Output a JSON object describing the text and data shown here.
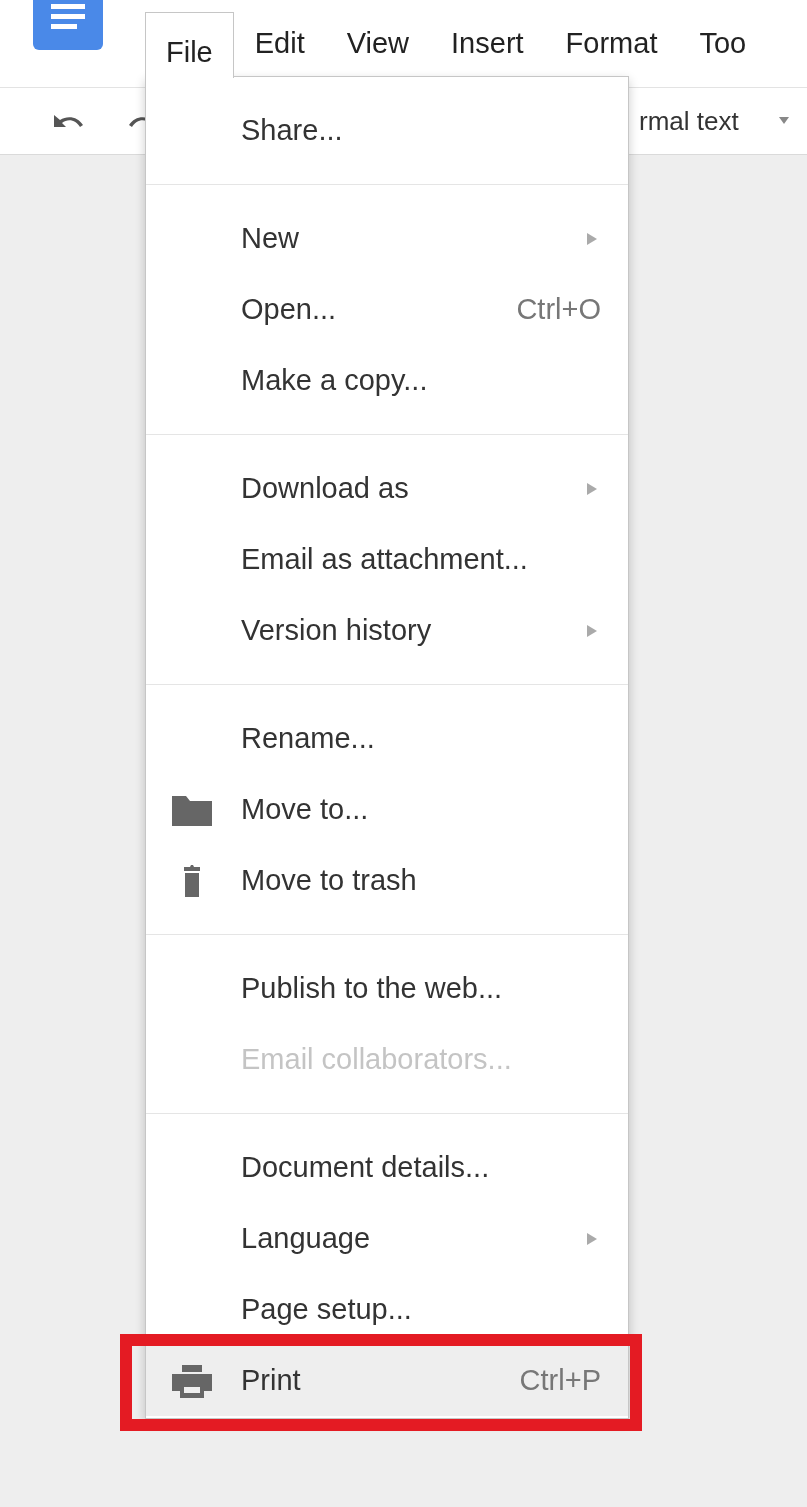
{
  "menubar": [
    {
      "label": "File",
      "selected": true
    },
    {
      "label": "Edit",
      "selected": false
    },
    {
      "label": "View",
      "selected": false
    },
    {
      "label": "Insert",
      "selected": false
    },
    {
      "label": "Format",
      "selected": false
    },
    {
      "label": "Too",
      "selected": false
    }
  ],
  "toolbar": {
    "style_dropdown": "rmal text"
  },
  "file_menu": {
    "sections": [
      {
        "items": [
          {
            "label": "Share...",
            "submenu": false,
            "disabled": false,
            "selected": false,
            "outlined": false
          }
        ]
      },
      {
        "items": [
          {
            "label": "New",
            "submenu": true,
            "disabled": false,
            "selected": false,
            "outlined": false
          },
          {
            "label": "Open...",
            "shortcut": "Ctrl+O",
            "submenu": false,
            "disabled": false,
            "selected": false,
            "outlined": false
          },
          {
            "label": "Make a copy...",
            "submenu": false,
            "disabled": false,
            "selected": false,
            "outlined": false
          }
        ]
      },
      {
        "items": [
          {
            "label": "Download as",
            "submenu": true,
            "disabled": false,
            "selected": false,
            "outlined": false
          },
          {
            "label": "Email as attachment...",
            "submenu": false,
            "disabled": false,
            "selected": false,
            "outlined": false
          },
          {
            "label": "Version history",
            "submenu": true,
            "disabled": false,
            "selected": false,
            "outlined": false
          }
        ]
      },
      {
        "items": [
          {
            "label": "Rename...",
            "submenu": false,
            "disabled": false,
            "selected": false,
            "outlined": false
          },
          {
            "label": "Move to...",
            "kind": "folder",
            "submenu": false,
            "disabled": false,
            "selected": false,
            "outlined": false
          },
          {
            "label": "Move to trash",
            "kind": "trash",
            "submenu": false,
            "disabled": false,
            "selected": false,
            "outlined": false
          }
        ]
      },
      {
        "items": [
          {
            "label": "Publish to the web...",
            "submenu": false,
            "disabled": false,
            "selected": false,
            "outlined": false
          },
          {
            "label": "Email collaborators...",
            "submenu": false,
            "disabled": true,
            "selected": false,
            "outlined": false
          }
        ]
      },
      {
        "items": [
          {
            "label": "Document details...",
            "submenu": false,
            "disabled": false,
            "selected": false,
            "outlined": false
          },
          {
            "label": "Language",
            "submenu": true,
            "disabled": false,
            "selected": false,
            "outlined": false
          },
          {
            "label": "Page setup...",
            "submenu": false,
            "disabled": false,
            "selected": false,
            "outlined": false
          },
          {
            "label": "Print",
            "kind": "printer",
            "shortcut": "Ctrl+P",
            "submenu": false,
            "disabled": false,
            "selected": true,
            "outlined": true
          }
        ]
      }
    ]
  }
}
